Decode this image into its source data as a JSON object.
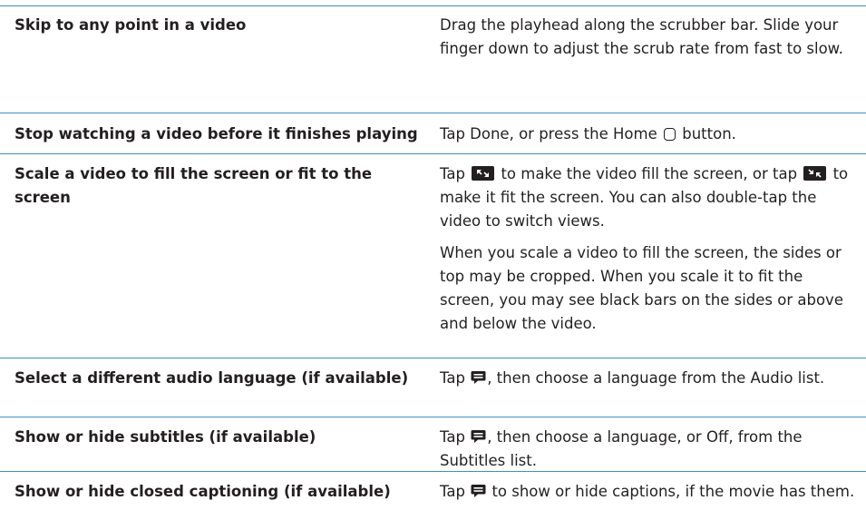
{
  "colors": {
    "rule": "#3e8fc6",
    "text": "#231f20"
  },
  "rows": [
    {
      "action": "Skip to any point in a video",
      "desc": "Drag the playhead along the scrubber bar. Slide your finger down to adjust the scrub rate from fast to slow."
    },
    {
      "action": "Stop watching a video before it finishes playing",
      "desc_a": "Tap Done, or press the Home",
      "desc_b": "button.",
      "icon": "home-button-icon"
    },
    {
      "action": "Scale a video to fill the screen or fit to the screen",
      "p1_a": "Tap",
      "p1_b": "to make the video fill the screen, or tap",
      "p1_c": "to make it fit the screen. You can also double-tap the video to switch views.",
      "p2": "When you scale a video to fill the screen, the sides or top may be cropped. When you scale it to fit the screen, you may see black bars on the sides or above and below the video.",
      "icons": [
        "fill-screen-icon",
        "fit-screen-icon"
      ]
    },
    {
      "action": "Select a different audio language (if available)",
      "desc_a": "Tap",
      "desc_b": ", then choose a language from the Audio list.",
      "icon": "speech-bubble-icon"
    },
    {
      "action": "Show or hide subtitles (if available)",
      "desc_a": "Tap",
      "desc_b": ", then choose a language, or Off, from the Subtitles list.",
      "icon": "speech-bubble-icon"
    },
    {
      "action": "Show or hide closed captioning (if available)",
      "desc_a": "Tap",
      "desc_b": "to show or hide captions, if the movie has them.",
      "icon": "speech-bubble-icon"
    }
  ]
}
